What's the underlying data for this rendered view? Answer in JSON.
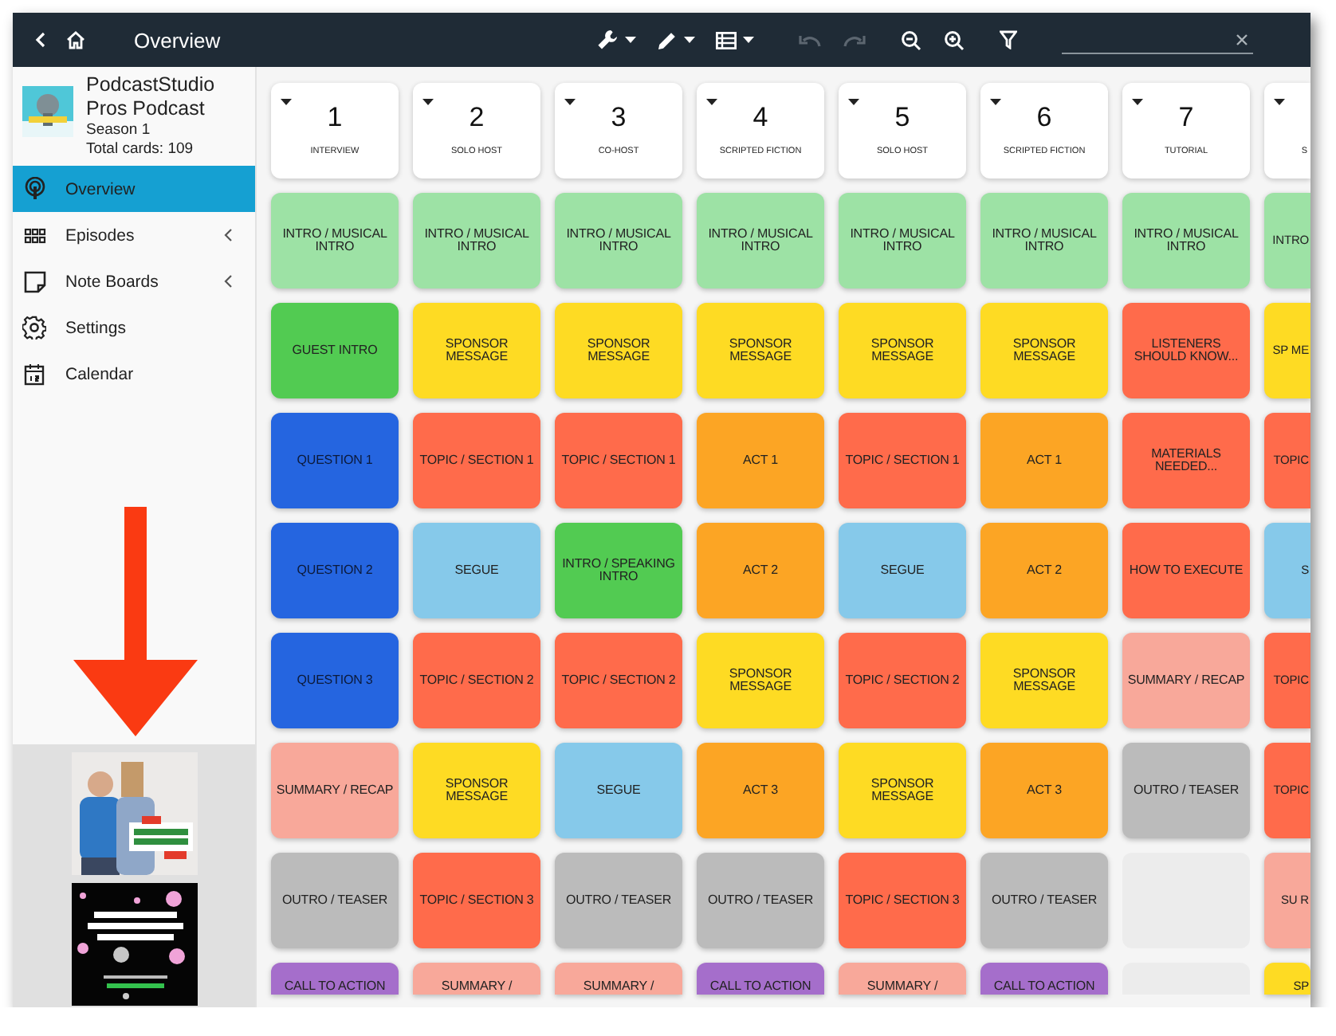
{
  "window": {
    "title": "Overview"
  },
  "toolbar": {
    "undo": {
      "disabled": true
    },
    "redo": {
      "disabled": true
    }
  },
  "sidebar": {
    "podcast": {
      "title": "PodcastStudio Pros Podcast",
      "season": "Season 1",
      "total": "Total cards: 109"
    },
    "nav": [
      {
        "label": "Overview",
        "selected": true
      },
      {
        "label": "Episodes",
        "selected": false,
        "expanded": false
      },
      {
        "label": "Note Boards",
        "selected": false,
        "expanded": false
      },
      {
        "label": "Settings",
        "selected": false
      },
      {
        "label": "Calendar",
        "selected": false
      }
    ]
  },
  "board": {
    "columns": [
      {
        "number": "1",
        "label": "INTERVIEW"
      },
      {
        "number": "2",
        "label": "SOLO HOST"
      },
      {
        "number": "3",
        "label": "CO-HOST"
      },
      {
        "number": "4",
        "label": "SCRIPTED FICTION"
      },
      {
        "number": "5",
        "label": "SOLO HOST"
      },
      {
        "number": "6",
        "label": "SCRIPTED FICTION"
      },
      {
        "number": "7",
        "label": "TUTORIAL"
      },
      {
        "label": "S",
        "cut": true
      }
    ],
    "rows": [
      [
        {
          "text": "INTRO / MUSICAL INTRO",
          "color": "#9de2a5"
        },
        {
          "text": "INTRO / MUSICAL INTRO",
          "color": "#9de2a5"
        },
        {
          "text": "INTRO / MUSICAL INTRO",
          "color": "#9de2a5"
        },
        {
          "text": "INTRO / MUSICAL INTRO",
          "color": "#9de2a5"
        },
        {
          "text": "INTRO / MUSICAL INTRO",
          "color": "#9de2a5"
        },
        {
          "text": "INTRO / MUSICAL INTRO",
          "color": "#9de2a5"
        },
        {
          "text": "INTRO / MUSICAL INTRO",
          "color": "#9de2a5"
        },
        {
          "text": "INTRO",
          "color": "#9de2a5"
        }
      ],
      [
        {
          "text": "GUEST INTRO",
          "color": "#52cb52"
        },
        {
          "text": "SPONSOR MESSAGE",
          "color": "#fedb23"
        },
        {
          "text": "SPONSOR MESSAGE",
          "color": "#fedb23"
        },
        {
          "text": "SPONSOR MESSAGE",
          "color": "#fedb23"
        },
        {
          "text": "SPONSOR MESSAGE",
          "color": "#fedb23"
        },
        {
          "text": "SPONSOR MESSAGE",
          "color": "#fedb23"
        },
        {
          "text": "LISTENERS SHOULD KNOW...",
          "color": "#ff6b4b"
        },
        {
          "text": "SP ME",
          "color": "#fedb23"
        }
      ],
      [
        {
          "text": "QUESTION 1",
          "color": "#2565e0"
        },
        {
          "text": "TOPIC / SECTION 1",
          "color": "#ff6b4b"
        },
        {
          "text": "TOPIC / SECTION 1",
          "color": "#ff6b4b"
        },
        {
          "text": "ACT 1",
          "color": "#fca524"
        },
        {
          "text": "TOPIC / SECTION 1",
          "color": "#ff6b4b"
        },
        {
          "text": "ACT 1",
          "color": "#fca524"
        },
        {
          "text": "MATERIALS NEEDED...",
          "color": "#ff6b4b"
        },
        {
          "text": "TOPIC",
          "color": "#ff6b4b"
        }
      ],
      [
        {
          "text": "QUESTION 2",
          "color": "#2565e0"
        },
        {
          "text": "SEGUE",
          "color": "#86c9ea"
        },
        {
          "text": "INTRO / SPEAKING INTRO",
          "color": "#52cb52"
        },
        {
          "text": "ACT 2",
          "color": "#fca524"
        },
        {
          "text": "SEGUE",
          "color": "#86c9ea"
        },
        {
          "text": "ACT 2",
          "color": "#fca524"
        },
        {
          "text": "HOW TO EXECUTE",
          "color": "#ff6b4b"
        },
        {
          "text": "S",
          "color": "#86c9ea"
        }
      ],
      [
        {
          "text": "QUESTION 3",
          "color": "#2565e0"
        },
        {
          "text": "TOPIC / SECTION 2",
          "color": "#ff6b4b"
        },
        {
          "text": "TOPIC / SECTION 2",
          "color": "#ff6b4b"
        },
        {
          "text": "SPONSOR MESSAGE",
          "color": "#fedb23"
        },
        {
          "text": "TOPIC / SECTION 2",
          "color": "#ff6b4b"
        },
        {
          "text": "SPONSOR MESSAGE",
          "color": "#fedb23"
        },
        {
          "text": "SUMMARY / RECAP",
          "color": "#f8a89a"
        },
        {
          "text": "TOPIC",
          "color": "#ff6b4b"
        }
      ],
      [
        {
          "text": "SUMMARY / RECAP",
          "color": "#f8a89a"
        },
        {
          "text": "SPONSOR MESSAGE",
          "color": "#fedb23"
        },
        {
          "text": "SEGUE",
          "color": "#86c9ea"
        },
        {
          "text": "ACT 3",
          "color": "#fca524"
        },
        {
          "text": "SPONSOR MESSAGE",
          "color": "#fedb23"
        },
        {
          "text": "ACT 3",
          "color": "#fca524"
        },
        {
          "text": "OUTRO / TEASER",
          "color": "#bbbbbb"
        },
        {
          "text": "TOPIC",
          "color": "#ff6b4b"
        }
      ],
      [
        {
          "text": "OUTRO / TEASER",
          "color": "#bbbbbb"
        },
        {
          "text": "TOPIC / SECTION 3",
          "color": "#ff6b4b"
        },
        {
          "text": "OUTRO / TEASER",
          "color": "#bbbbbb"
        },
        {
          "text": "OUTRO / TEASER",
          "color": "#bbbbbb"
        },
        {
          "text": "TOPIC / SECTION 3",
          "color": "#ff6b4b"
        },
        {
          "text": "OUTRO / TEASER",
          "color": "#bbbbbb"
        },
        {
          "kind": "empty"
        },
        {
          "text": "SU R",
          "color": "#f8a89a"
        }
      ],
      [
        {
          "text": "CALL TO ACTION",
          "color": "#a56ecb"
        },
        {
          "text": "SUMMARY /",
          "color": "#f8a89a"
        },
        {
          "text": "SUMMARY /",
          "color": "#f8a89a"
        },
        {
          "text": "CALL TO ACTION",
          "color": "#a56ecb"
        },
        {
          "text": "SUMMARY /",
          "color": "#f8a89a"
        },
        {
          "text": "CALL TO ACTION",
          "color": "#a56ecb"
        },
        {
          "kind": "empty"
        },
        {
          "text": "SP",
          "color": "#fedb23"
        }
      ]
    ]
  }
}
